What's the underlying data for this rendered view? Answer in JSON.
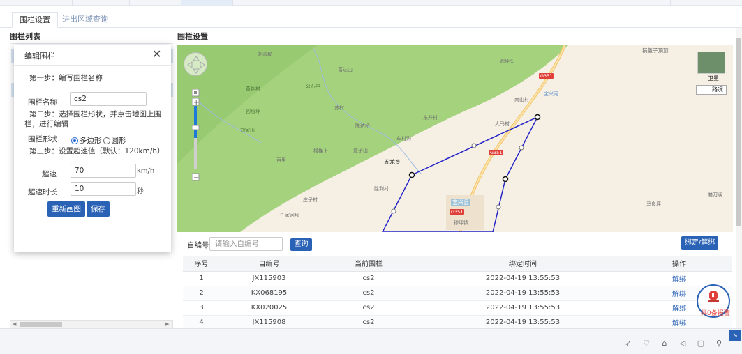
{
  "tabs": [
    {
      "label": "围栏设置"
    },
    {
      "label": "进出区域查询"
    }
  ],
  "left_section_title": "围栏列表",
  "right_section_title": "围栏设置",
  "dialog": {
    "title": "编辑围栏",
    "close_glyph": "✕",
    "step1": "第一步：编写围栏名称",
    "name_label": "围栏名称",
    "name_value": "cs2",
    "step2": "第二步：选择围栏形状，并点击地图上围栏，进行编辑",
    "shape_label": "围栏形状",
    "shape_options": [
      "多边形",
      "圆形"
    ],
    "shape_selected": "多边形",
    "step3": "第三步：设置超速值（默认：120km/h）",
    "speed_label": "超速",
    "speed_value": "70",
    "speed_unit": "km/h",
    "duration_label": "超速时长",
    "duration_value": "10",
    "duration_unit": "秒",
    "redraw_button": "重新画图",
    "save_button": "保存"
  },
  "map": {
    "satellite_label": "卫星",
    "road_label": "路况",
    "place_labels": [
      "刘湾坳",
      "富达山",
      "黄荆村",
      "观坪头",
      "公石屯",
      "苏村",
      "初垭坪",
      "东升村",
      "南山村",
      "刘家山",
      "陈达桥",
      "车村沟",
      "大马村",
      "橫梯上",
      "道子山",
      "五龙乡",
      "百里",
      "胜利村",
      "庄子村",
      "任家河坝",
      "宝兴县",
      "穆坪镇",
      "马良坪",
      "锅盖子顶顶",
      "磨刀溪"
    ],
    "road_badges": [
      "G351",
      "G351",
      "G351"
    ],
    "river_label": "宝兴河"
  },
  "search": {
    "label": "自编号",
    "placeholder": "请输入自编号",
    "query_button": "查询",
    "bind_button": "绑定/解绑"
  },
  "table": {
    "headers": [
      "序号",
      "自编号",
      "当前围栏",
      "绑定时间",
      "操作"
    ],
    "rows": [
      {
        "index": "1",
        "code": "JX115903",
        "fence": "cs2",
        "time": "2022-04-19 13:55:53",
        "op": "解绑"
      },
      {
        "index": "2",
        "code": "KX068195",
        "fence": "cs2",
        "time": "2022-04-19 13:55:53",
        "op": "解绑"
      },
      {
        "index": "3",
        "code": "KX020025",
        "fence": "cs2",
        "time": "2022-04-19 13:55:53",
        "op": "解绑"
      },
      {
        "index": "4",
        "code": "JX115908",
        "fence": "cs2",
        "time": "2022-04-19 13:55:53",
        "op": "解绑"
      }
    ]
  },
  "alarm": {
    "label": "共0条报警"
  },
  "colors": {
    "primary": "#2a62b5",
    "alarm_red": "#e0403a",
    "fence_line": "#2323c8",
    "map_green": "#9fd07a"
  }
}
